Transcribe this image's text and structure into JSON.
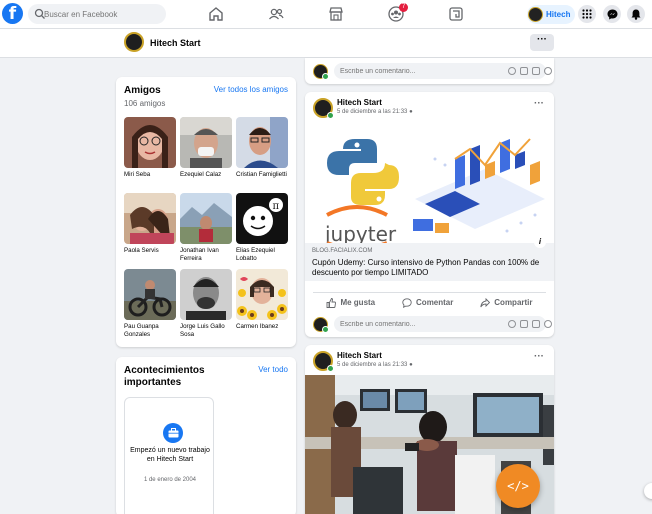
{
  "topnav": {
    "logo": "f",
    "search_placeholder": "Buscar en Facebook",
    "notification_count": "7",
    "profile_name": "Hitech"
  },
  "profilebar": {
    "name": "Hitech Start",
    "menu": "···"
  },
  "friends": {
    "title": "Amigos",
    "count": "106 amigos",
    "see_all": "Ver todos los amigos",
    "list": [
      {
        "name": "Miri Seba"
      },
      {
        "name": "Ezequiel Calaz"
      },
      {
        "name": "Cristian Famiglietti"
      },
      {
        "name": "Paola Servis"
      },
      {
        "name": "Jonathan Ivan Ferreira"
      },
      {
        "name": "Elias Ezequiel Lobatto"
      },
      {
        "name": "Pau Guanpa Gonzales"
      },
      {
        "name": "Jorge Luis Gallo Sosa"
      },
      {
        "name": "Carmen Ibanez"
      }
    ]
  },
  "events": {
    "title": "Acontecimientos importantes",
    "see_all": "Ver todo",
    "item_title": "Empezó un nuevo trabajo en Hitech Start",
    "item_date": "1 de enero de 2004"
  },
  "comment_placeholder": "Escribe un comentario...",
  "posts": [
    {
      "author": "Hitech Start",
      "date": "5 de diciembre a las 21:33",
      "link_domain": "BLOG.FACIALIX.COM",
      "link_title": "Cupón Udemy: Curso intensivo de Python Pandas con 100% de descuento por tiempo LIMITADO",
      "image_text": "jupyter",
      "actions": {
        "like": "Me gusta",
        "comment": "Comentar",
        "share": "Compartir"
      }
    },
    {
      "author": "Hitech Start",
      "date": "5 de diciembre a las 21:33"
    }
  ],
  "fab_label": "</>",
  "colors": {
    "brand": "#1877f2",
    "badge": "#e41e3f",
    "fab": "#f08a24"
  }
}
